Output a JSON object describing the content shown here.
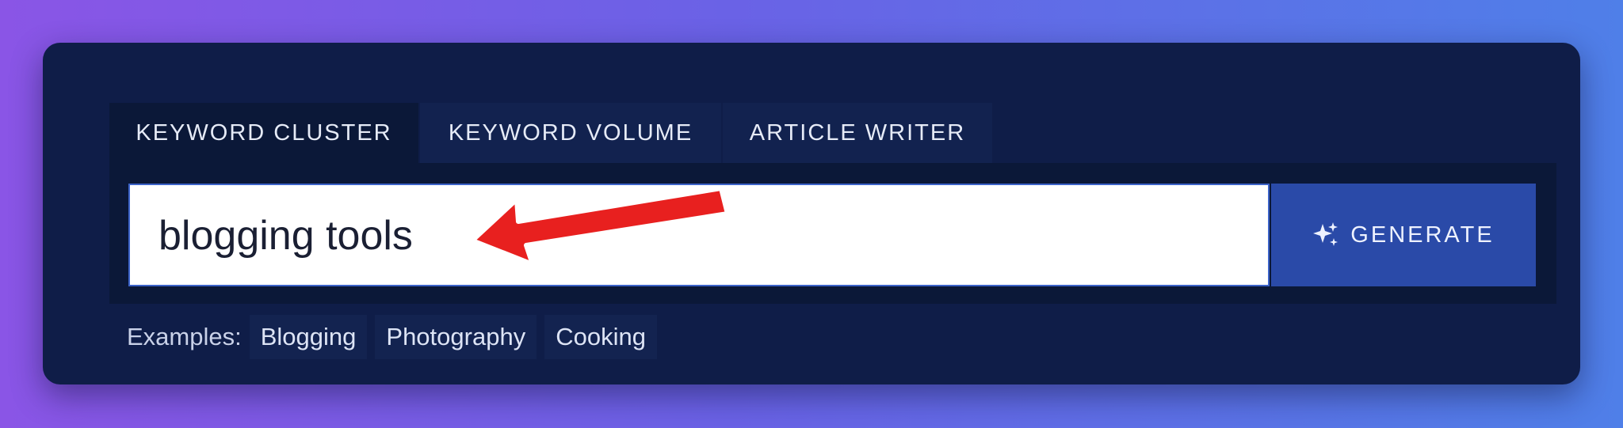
{
  "tabs": [
    {
      "label": "KEYWORD CLUSTER",
      "active": true
    },
    {
      "label": "KEYWORD VOLUME",
      "active": false
    },
    {
      "label": "ARTICLE WRITER",
      "active": false
    }
  ],
  "search": {
    "value": "blogging tools",
    "button_label": "GENERATE",
    "button_icon": "sparkle-icon"
  },
  "examples": {
    "label": "Examples:",
    "items": [
      "Blogging",
      "Photography",
      "Cooking"
    ]
  },
  "annotation": {
    "icon": "red-arrow-icon",
    "color": "#e8201f"
  },
  "colors": {
    "card": "#0f1d48",
    "accent": "#2a4aa8",
    "active_tab": "#0b1838"
  }
}
